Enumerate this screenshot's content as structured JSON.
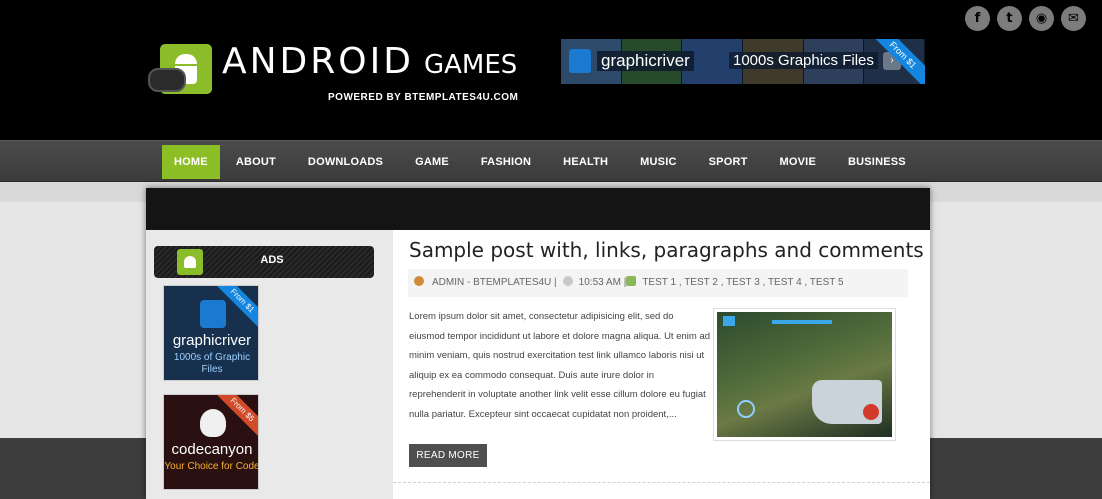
{
  "site": {
    "logo_main": "ANDROID",
    "logo_sub": "GAMES",
    "powered": "POWERED BY BTEMPLATES4U.COM"
  },
  "social": [
    {
      "icon": "facebook-icon",
      "glyph": "f"
    },
    {
      "icon": "twitter-icon",
      "glyph": "t"
    },
    {
      "icon": "rss-icon",
      "glyph": "◉"
    },
    {
      "icon": "email-icon",
      "glyph": "✉"
    }
  ],
  "banner": {
    "brand": "graphicriver",
    "text": "1000s Graphics Files",
    "ribbon": "From $1"
  },
  "nav": {
    "items": [
      "HOME",
      "ABOUT",
      "DOWNLOADS",
      "GAME",
      "FASHION",
      "HEALTH",
      "MUSIC",
      "SPORT",
      "MOVIE",
      "BUSINESS"
    ],
    "active": "HOME"
  },
  "sidebar": {
    "widget_title": "ADS",
    "ads": [
      {
        "brand": "graphicriver",
        "sub": "1000s of Graphic Files",
        "ribbon": "From $1"
      },
      {
        "brand": "codecanyon",
        "sub": "Your Choice for Code",
        "ribbon": "From $5"
      }
    ]
  },
  "post": {
    "title": "Sample post with, links, paragraphs and comments",
    "author": "ADMIN - BTEMPLATES4U",
    "time": "10:53 AM",
    "tags": "TEST 1 , TEST 2 , TEST 3 , TEST 4 , TEST 5",
    "body": "Lorem ipsum dolor sit amet, consectetur adipisicing elit, sed do eiusmod tempor incididunt ut labore et dolore magna aliqua. Ut enim ad minim veniam, quis nostrud exercitation test link ullamco laboris nisi ut aliquip ex ea commodo consequat. Duis aute irure dolor in reprehenderit in voluptate another link velit esse cillum dolore eu fugiat nulla pariatur. Excepteur sint occaecat cupidatat non proident,...",
    "read_more": "READ MORE"
  },
  "colors": {
    "accent": "#8cbf26",
    "header_bg": "#000000",
    "nav_bg": "#444444"
  }
}
